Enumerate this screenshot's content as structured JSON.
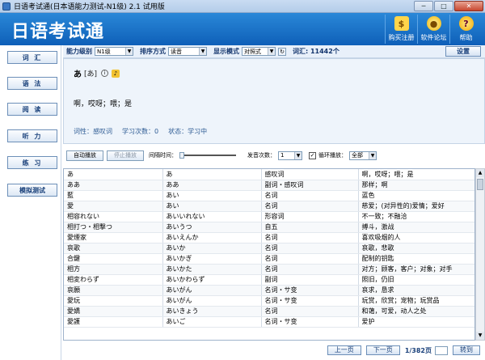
{
  "window": {
    "title": "日语考试通(日本语能力测试-N1级) 2.1 试用版",
    "min_label": "─",
    "max_label": "□",
    "close_label": "✕"
  },
  "header": {
    "brand": "日语考试通",
    "buttons": [
      {
        "label": "购买注册",
        "glyph": "$"
      },
      {
        "label": "软件论坛",
        "glyph": "●"
      },
      {
        "label": "帮助",
        "glyph": "?"
      }
    ]
  },
  "sidebar": {
    "items": [
      "词 汇",
      "语 法",
      "阅 读",
      "听 力",
      "练 习",
      "模拟测试"
    ]
  },
  "settings": {
    "level_label": "能力级别",
    "level_value": "N1级",
    "sort_label": "排序方式",
    "sort_value": "读音",
    "display_label": "显示模式",
    "display_value": "对照式",
    "refresh_glyph": "↻",
    "vocab_count": "词汇: 11442个",
    "setup_label": "设置"
  },
  "word": {
    "word": "あ",
    "reading": "[あ]",
    "info_glyph": "i",
    "speaker_glyph": "♪",
    "meaning": "啊，哎呀；喂；是",
    "pos": "词性：感叹词",
    "study_count": "学习次数：0",
    "status": "状态：学习中"
  },
  "controls": {
    "auto_play": "自动播放",
    "stop_play": "停止播放",
    "interval_label": "间隔时间：",
    "interval_level": 0,
    "repeat_label": "发音次数：",
    "repeat_value": "1",
    "loop_label": "循环播放：",
    "loop_checked": "✓",
    "loop_value": "全部"
  },
  "table": {
    "rows": [
      [
        "あ",
        "あ",
        "感叹词",
        "啊，哎呀；喂；是"
      ],
      [
        "ああ",
        "ああ",
        "副词・感叹词",
        "那样；啊"
      ],
      [
        "藍",
        "あい",
        "名词",
        "蓝色"
      ],
      [
        "愛",
        "あい",
        "名词",
        "慈爱；(对异性的)爱情；爱好"
      ],
      [
        "相容れない",
        "あいいれない",
        "形容词",
        "不一致；不融洽"
      ],
      [
        "相打つ・相撃つ",
        "あいうつ",
        "自五",
        "搏斗，激战"
      ],
      [
        "愛煙家",
        "あいえんか",
        "名词",
        "喜欢吸烟的人"
      ],
      [
        "哀歌",
        "あいか",
        "名词",
        "哀歌，悲歌"
      ],
      [
        "合鍵",
        "あいかぎ",
        "名词",
        "配制的钥匙"
      ],
      [
        "相方",
        "あいかた",
        "名词",
        "对方；顾客，客户；对象；对手"
      ],
      [
        "相変わらず",
        "あいかわらず",
        "副词",
        "照旧，仍旧"
      ],
      [
        "哀願",
        "あいがん",
        "名词・サ变",
        "哀求，恳求"
      ],
      [
        "愛玩",
        "あいがん",
        "名词・サ变",
        "玩赏，欣赏；宠物；玩赏品"
      ],
      [
        "愛嬌",
        "あいきょう",
        "名词",
        "和蔼，可爱，动人之处"
      ],
      [
        "愛護",
        "あいご",
        "名词・サ变",
        "爱护"
      ]
    ],
    "scroll_up": "▲",
    "scroll_down": "▼"
  },
  "pager": {
    "prev": "上一页",
    "next": "下一页",
    "info": "1/382页",
    "goto": "转到"
  }
}
